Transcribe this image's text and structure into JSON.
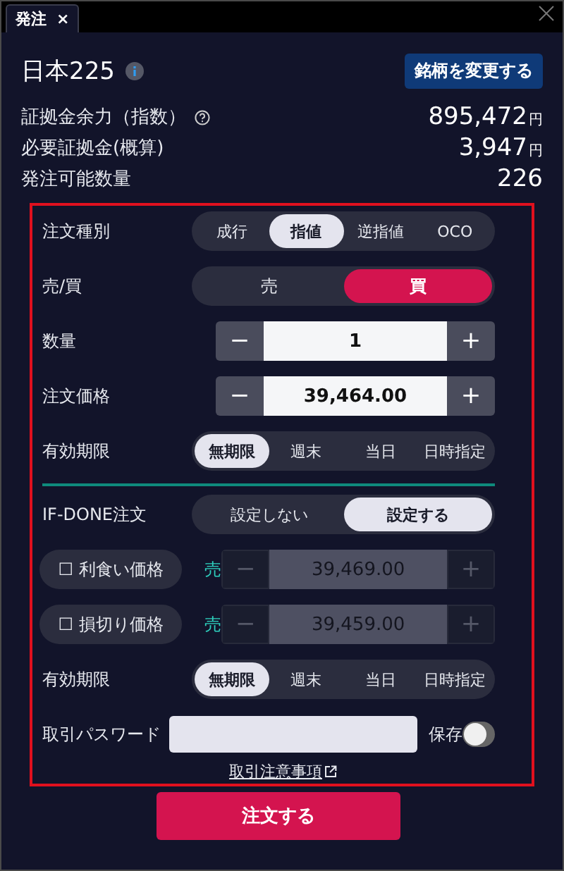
{
  "tab": {
    "label": "発注",
    "close": "×"
  },
  "instrument": {
    "name": "日本225",
    "change_button": "銘柄を変更する"
  },
  "account": [
    {
      "label": "証拠金余力（指数）",
      "help": true,
      "value": "895,472",
      "unit": "円"
    },
    {
      "label": "必要証拠金(概算)",
      "help": false,
      "value": "3,947",
      "unit": "円"
    },
    {
      "label": "発注可能数量",
      "help": false,
      "value": "226"
    }
  ],
  "sections": [
    {
      "rows": [
        {
          "kind": "segmented",
          "label": "注文種別",
          "options": [
            {
              "label": "成行",
              "selected": false
            },
            {
              "label": "指値",
              "selected": true
            },
            {
              "label": "逆指値",
              "selected": false
            },
            {
              "label": "OCO",
              "selected": false
            }
          ]
        },
        {
          "kind": "side",
          "label": "売/買",
          "options": [
            {
              "label": "売",
              "selected": false
            },
            {
              "label": "買",
              "selected": true
            }
          ]
        },
        {
          "kind": "stepper",
          "label": "数量",
          "minus": "−",
          "value": "1",
          "plus": "+"
        },
        {
          "kind": "stepper",
          "label": "注文価格",
          "minus": "−",
          "value": "39,464.00",
          "plus": "+"
        },
        {
          "kind": "segmented",
          "label": "有効期限",
          "options": [
            {
              "label": "無期限",
              "selected": true
            },
            {
              "label": "週末",
              "selected": false
            },
            {
              "label": "当日",
              "selected": false
            },
            {
              "label": "日時指定",
              "selected": false
            }
          ]
        }
      ]
    },
    {
      "rows": [
        {
          "kind": "segmented",
          "label": "IF-DONE注文",
          "options": [
            {
              "label": "設定しない",
              "selected": false
            },
            {
              "label": "設定する",
              "selected": true
            }
          ]
        },
        {
          "kind": "sub_order",
          "toggle": "☐ 利食い価格",
          "side": "売",
          "minus": "−",
          "value": "39,469.00",
          "plus": "+",
          "disabled": true
        },
        {
          "kind": "sub_order",
          "toggle": "☐ 損切り価格",
          "side": "売",
          "minus": "−",
          "value": "39,459.00",
          "plus": "+",
          "disabled": true
        },
        {
          "kind": "segmented",
          "label": "有効期限",
          "options": [
            {
              "label": "無期限",
              "selected": true
            },
            {
              "label": "週末",
              "selected": false
            },
            {
              "label": "当日",
              "selected": false
            },
            {
              "label": "日時指定",
              "selected": false
            }
          ]
        },
        {
          "kind": "password",
          "label": "取引パスワード",
          "save_label": "保存",
          "save_on": false
        }
      ]
    }
  ],
  "notice_link": "取引注意事項",
  "submit_button": "注文する"
}
